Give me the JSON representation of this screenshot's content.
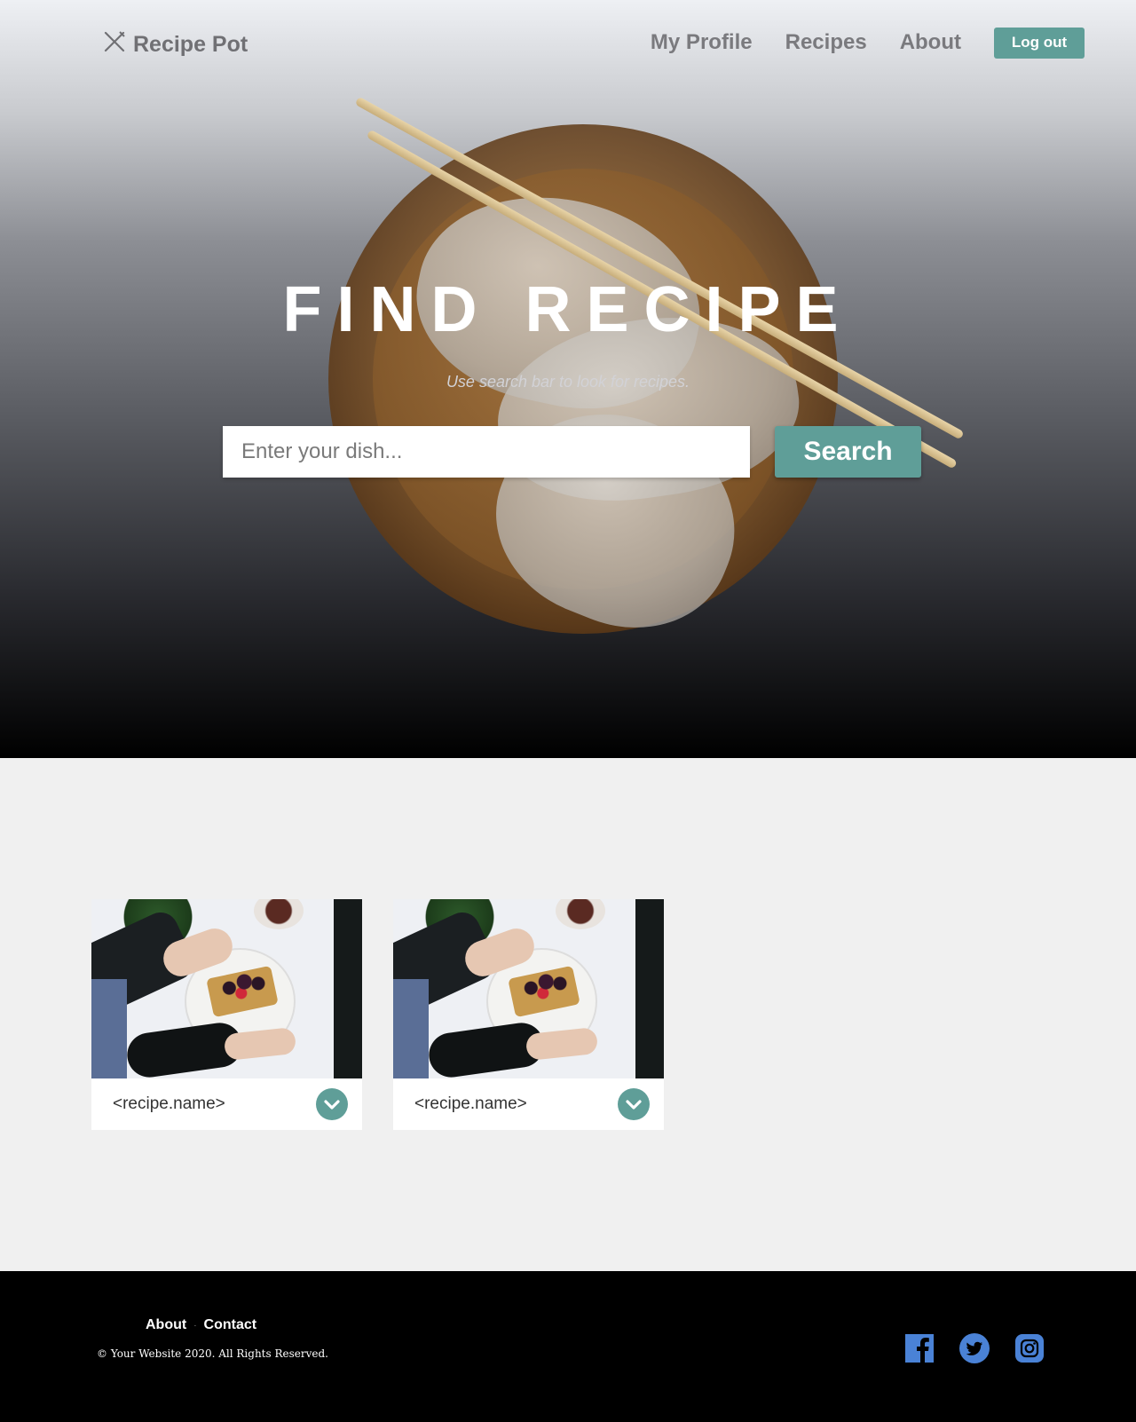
{
  "nav": {
    "brand": "Recipe Pot",
    "links": [
      "My Profile",
      "Recipes",
      "About"
    ],
    "logout_label": "Log out"
  },
  "hero": {
    "title": "FIND RECIPE",
    "subtitle": "Use search bar to look for recipes.",
    "search_placeholder": "Enter your dish...",
    "search_label": "Search"
  },
  "cards": [
    {
      "name": "<recipe.name>"
    },
    {
      "name": "<recipe.name>"
    }
  ],
  "footer": {
    "links": [
      "About",
      "Contact"
    ],
    "separator": "·",
    "copyright": "© Your Website 2020. All Rights Reserved.",
    "socials": [
      "facebook-icon",
      "twitter-icon",
      "instagram-icon"
    ]
  },
  "colors": {
    "accent": "#5f9e98",
    "social": "#4a82d6"
  }
}
